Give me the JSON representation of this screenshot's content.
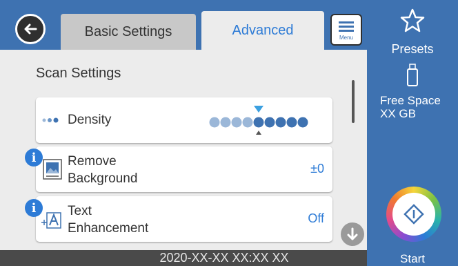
{
  "header": {
    "tab_basic": "Basic Settings",
    "tab_advanced": "Advanced",
    "menu_label": "Menu"
  },
  "main": {
    "section_title": "Scan Settings",
    "rows": [
      {
        "label": "Density",
        "value": ""
      },
      {
        "label_line1": "Remove",
        "label_line2": "Background",
        "value": "±0",
        "info": "i"
      },
      {
        "label_line1": "Text",
        "label_line2": "Enhancement",
        "value": "Off",
        "info": "i"
      }
    ],
    "density_level": 5,
    "density_steps": 9
  },
  "sidebar": {
    "presets_label": "Presets",
    "free_space_line1": "Free Space",
    "free_space_line2": "XX GB",
    "start_label": "Start"
  },
  "status": {
    "datetime": "2020-XX-XX XX:XX XX"
  },
  "colors": {
    "accent": "#3e72b1",
    "link": "#2d7bd6"
  }
}
